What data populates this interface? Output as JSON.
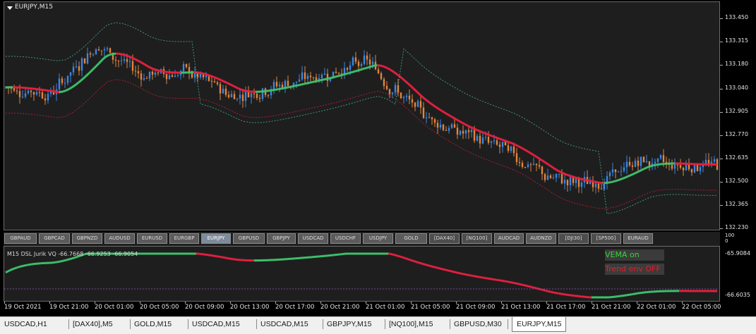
{
  "chart_title": "EURJPY,M15",
  "price_ticks": [
    "133.450",
    "133.315",
    "133.180",
    "133.040",
    "132.905",
    "132.770",
    "132.635",
    "132.500",
    "132.365",
    "132.230"
  ],
  "subaxis_top_labels": [
    "100",
    "0"
  ],
  "sub_ticks": [
    "-65.9084",
    "-66.6035"
  ],
  "time_ticks": [
    "19 Oct 2021",
    "19 Oct 21:00",
    "20 Oct 01:00",
    "20 Oct 05:00",
    "20 Oct 09:00",
    "20 Oct 13:00",
    "20 Oct 17:00",
    "20 Oct 21:00",
    "21 Oct 01:00",
    "21 Oct 05:00",
    "21 Oct 09:00",
    "21 Oct 13:00",
    "21 Oct 17:00",
    "21 Oct 21:00",
    "22 Oct 01:00",
    "22 Oct 05:00"
  ],
  "symbol_buttons": [
    "GBPAUD",
    "GBPCAD",
    "GBPNZD",
    "AUDUSD",
    "EURUSD",
    "EURGBP",
    "EURJPY",
    "GBPUSD",
    "GBPJPY",
    "USDCAD",
    "USDCHF",
    "USDJPY",
    "GOLD",
    "[DAX40]",
    "[NQ100]",
    "AUDCAD",
    "AUDNZD",
    "[DJI30]",
    "[SP500]",
    "EURAUD"
  ],
  "active_symbol": "EURJPY",
  "indicator_label": "M15 DSL Jurik VQ -66.7668 -66.9253 -66.9054",
  "vema_button": "VEMA on",
  "trend_button": "Trend env OFF",
  "tabs": [
    "USDCAD,H1",
    "[DAX40],M5",
    "GOLD,M15",
    "USDCAD,M15",
    "USDCAD,M15",
    "GBPJPY,M15",
    "[NQ100],M15",
    "GBPUSD,M30",
    "EURJPY,M15"
  ],
  "active_tab": "EURJPY,M15",
  "colors": {
    "bull": "#3b86e0",
    "bear": "#e4853e",
    "ma_up": "#3ec06b",
    "ma_down": "#e3203f",
    "background": "#1e1e1e"
  },
  "chart_data": {
    "type": "line",
    "title": "EURJPY,M15",
    "ylim": [
      132.23,
      133.45
    ],
    "x": [
      "19 Oct 2021",
      "19 Oct 21:00",
      "20 Oct 01:00",
      "20 Oct 05:00",
      "20 Oct 09:00",
      "20 Oct 13:00",
      "20 Oct 17:00",
      "20 Oct 21:00",
      "21 Oct 01:00",
      "21 Oct 05:00",
      "21 Oct 09:00",
      "21 Oct 13:00",
      "21 Oct 17:00",
      "21 Oct 21:00",
      "22 Oct 01:00",
      "22 Oct 05:00"
    ],
    "series": [
      {
        "values": [
          133.05,
          133.01,
          133.3,
          133.12,
          133.14,
          133.0,
          133.06,
          133.12,
          133.2,
          132.93,
          132.79,
          132.7,
          132.52,
          132.48,
          132.62,
          132.6
        ]
      }
    ]
  }
}
